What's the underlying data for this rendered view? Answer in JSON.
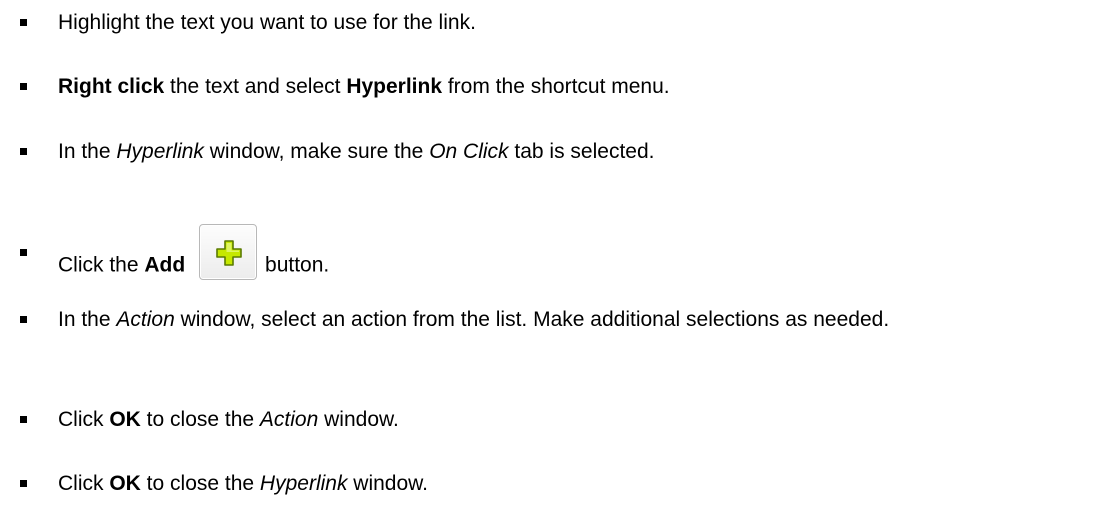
{
  "steps": [
    {
      "segments": [
        {
          "text": "Highlight the text you want to use for the link.",
          "style": "normal"
        }
      ]
    },
    {
      "segments": [
        {
          "text": "Right click",
          "style": "bold"
        },
        {
          "text": " the text and select ",
          "style": "normal"
        },
        {
          "text": "Hyperlink",
          "style": "bold"
        },
        {
          "text": " from the shortcut menu.",
          "style": "normal"
        }
      ]
    },
    {
      "segments": [
        {
          "text": "In the ",
          "style": "normal"
        },
        {
          "text": "Hyperlink",
          "style": "italic"
        },
        {
          "text": " window, make sure the ",
          "style": "normal"
        },
        {
          "text": "On Click",
          "style": "italic"
        },
        {
          "text": " tab is selected.",
          "style": "normal"
        }
      ]
    },
    {
      "segments": [
        {
          "text": "Click the ",
          "style": "normal"
        },
        {
          "text": "Add",
          "style": "bold"
        },
        {
          "text": " ",
          "style": "normal"
        }
      ],
      "after": [
        {
          "text": "button.",
          "style": "normal"
        }
      ],
      "icon": "add-plus-icon"
    },
    {
      "segments": [
        {
          "text": "In the ",
          "style": "normal"
        },
        {
          "text": "Action",
          "style": "italic"
        },
        {
          "text": " window, select an action from the list. Make additional selections as needed.",
          "style": "normal"
        }
      ]
    },
    {
      "segments": [
        {
          "text": "Click ",
          "style": "normal"
        },
        {
          "text": "OK",
          "style": "bold"
        },
        {
          "text": " to close the ",
          "style": "normal"
        },
        {
          "text": "Action",
          "style": "italic"
        },
        {
          "text": " window.",
          "style": "normal"
        }
      ]
    },
    {
      "segments": [
        {
          "text": "Click ",
          "style": "normal"
        },
        {
          "text": "OK",
          "style": "bold"
        },
        {
          "text": " to close the ",
          "style": "normal"
        },
        {
          "text": "Hyperlink",
          "style": "italic"
        },
        {
          "text": " window.",
          "style": "normal"
        }
      ]
    }
  ],
  "colors": {
    "plus_fill": "#c6e800",
    "plus_stroke": "#5a7a00"
  }
}
